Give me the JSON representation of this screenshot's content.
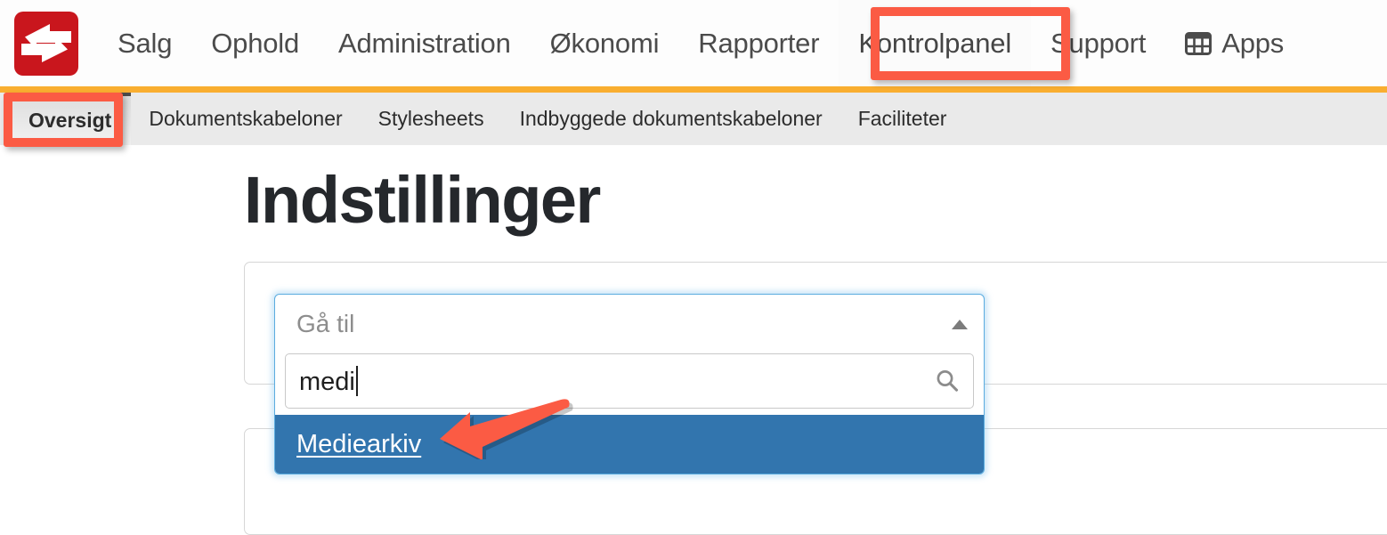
{
  "brand": {
    "logo_icon": "two-way-arrows-logo",
    "logo_color": "#c9161d"
  },
  "topnav": {
    "items": [
      {
        "label": "Salg",
        "name": "nav-item-salg",
        "highlighted": false
      },
      {
        "label": "Ophold",
        "name": "nav-item-ophold",
        "highlighted": false
      },
      {
        "label": "Administration",
        "name": "nav-item-administration",
        "highlighted": false
      },
      {
        "label": "Økonomi",
        "name": "nav-item-okonomi",
        "highlighted": false
      },
      {
        "label": "Rapporter",
        "name": "nav-item-rapporter",
        "highlighted": false
      },
      {
        "label": "Kontrolpanel",
        "name": "nav-item-kontrolpanel",
        "highlighted": true
      },
      {
        "label": "Support",
        "name": "nav-item-support",
        "highlighted": false
      }
    ],
    "apps": {
      "label": "Apps",
      "icon": "grid-apps-icon"
    },
    "text_color": "#4b4b4b",
    "rule_color": "#f9ae30"
  },
  "subnav": {
    "background": "#eaeaea",
    "items": [
      {
        "label": "Oversigt",
        "active": true
      },
      {
        "label": "Dokumentskabeloner",
        "active": false
      },
      {
        "label": "Stylesheets",
        "active": false
      },
      {
        "label": "Indbyggede dokumentskabeloner",
        "active": false
      },
      {
        "label": "Faciliteter",
        "active": false
      }
    ]
  },
  "main": {
    "title": "Indstillinger"
  },
  "dropdown": {
    "placeholder": "Gå til",
    "caret_icon": "chevron-up-icon",
    "search": {
      "value": "medi",
      "icon": "search-icon"
    },
    "options": [
      {
        "label": "Mediearkiv",
        "highlighted": true
      }
    ],
    "highlight_color": "#3275ae",
    "focus_border_color": "#5bacdf"
  },
  "annotations": {
    "color": "#fb5b44",
    "boxes": [
      {
        "target": "Kontrolpanel"
      },
      {
        "target": "Oversigt"
      }
    ],
    "arrow": {
      "points_to": "Mediearkiv",
      "direction": "left"
    }
  }
}
